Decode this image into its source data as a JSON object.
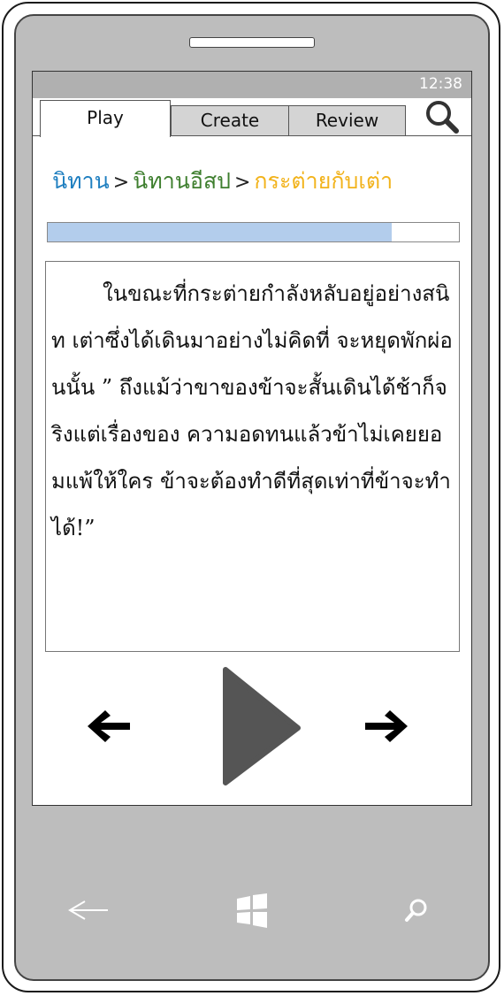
{
  "status_bar": {
    "time": "12:38"
  },
  "tabs": [
    {
      "label": "Play",
      "active": true
    },
    {
      "label": "Create",
      "active": false
    },
    {
      "label": "Review",
      "active": false
    }
  ],
  "breadcrumb": {
    "items": [
      {
        "label": "นิทาน",
        "color": "#1f7fc0"
      },
      {
        "label": "นิทานอีสป",
        "color": "#3f7f2f"
      },
      {
        "label": "กระต่ายกับเต่า",
        "color": "#f2b31c"
      }
    ],
    "separator": ">"
  },
  "progress": {
    "fraction": 0.837,
    "color": "#b3cdec"
  },
  "story": {
    "text": "ในขณะที่กระต่ายกำลังหลับอยู่อย่างสนิท เต่าซึ่งได้เดินมาอย่างไม่คิดที่ จะหยุดพักผ่อนนั้น ” ถึงแม้ว่าขาของข้าจะสั้นเดินได้ช้าก็จริงแต่เรื่องของ ความอดทนแล้วข้าไม่เคยยอมแพ้ให้ใคร ข้าจะต้องทำดีที่สุดเท่าที่ข้าจะทำได้!”"
  },
  "controls": {
    "back_icon": "arrow-left-icon",
    "play_icon": "play-icon",
    "forward_icon": "arrow-right-icon"
  },
  "hardware_buttons": [
    "back-icon",
    "windows-icon",
    "search-icon"
  ]
}
